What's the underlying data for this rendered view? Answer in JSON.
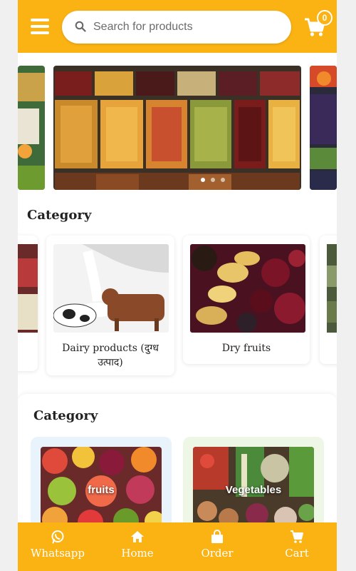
{
  "header": {
    "search_placeholder": "Search for products",
    "cart_count": "0"
  },
  "banner": {
    "slides": 3,
    "active_dot": 0
  },
  "category_carousel": {
    "title": "Category",
    "items": [
      {
        "label": "Dairy products (दुग्ध उत्पाद)"
      },
      {
        "label": "Dry fruits"
      }
    ]
  },
  "category_grid": {
    "title": "Category",
    "items": [
      {
        "label": "fruits"
      },
      {
        "label": "Vegetables"
      }
    ]
  },
  "bottom_nav": {
    "items": [
      {
        "label": "Whatsapp",
        "icon": "whatsapp-icon"
      },
      {
        "label": "Home",
        "icon": "home-icon"
      },
      {
        "label": "Order",
        "icon": "bag-icon"
      },
      {
        "label": "Cart",
        "icon": "cart-icon"
      }
    ]
  },
  "colors": {
    "brand": "#fbb213",
    "white": "#ffffff"
  }
}
